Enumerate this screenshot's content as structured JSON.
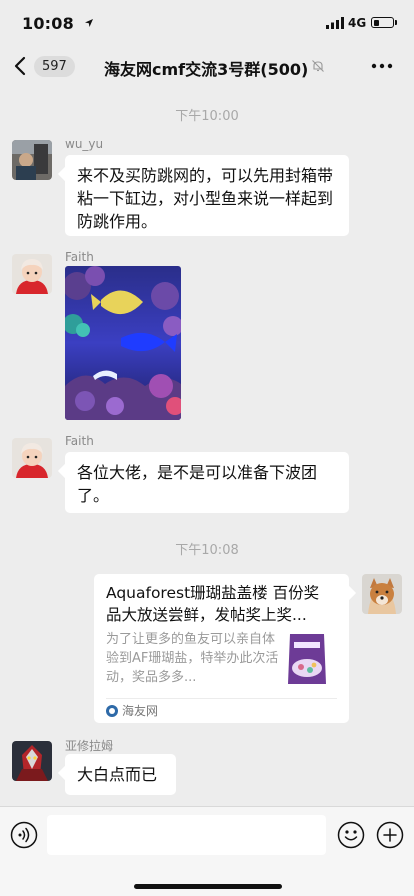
{
  "status_bar": {
    "time": "10:08",
    "network": "4G",
    "battery_level": 0.35
  },
  "nav": {
    "unread_count": "597",
    "title": "海友网cmf交流3号群(500)"
  },
  "messages": {
    "time_1": "下午10:00",
    "msg1": {
      "sender": "wu_yu",
      "text": "来不及买防跳网的，可以先用封箱带粘一下缸边，对小型鱼来说一样起到防跳作用。"
    },
    "msg2": {
      "sender": "Faith"
    },
    "msg3": {
      "sender": "Faith",
      "text": "各位大佬，是不是可以准备下波团了。"
    },
    "time_2": "下午10:08",
    "link": {
      "title": "Aquaforest珊瑚盐盖楼 百份奖品大放送尝鲜，发帖奖上奖...",
      "description": "为了让更多的鱼友可以亲自体验到AF珊瑚盐，特举办此次活动，奖品多多...",
      "source": "海友网"
    },
    "msg5": {
      "sender": "亚修拉姆",
      "text": "大白点而已"
    }
  },
  "input": {
    "value": "",
    "placeholder": ""
  },
  "colors": {
    "background": "#ededed",
    "bubble": "#ffffff",
    "meta_text": "#a8a8a8"
  }
}
